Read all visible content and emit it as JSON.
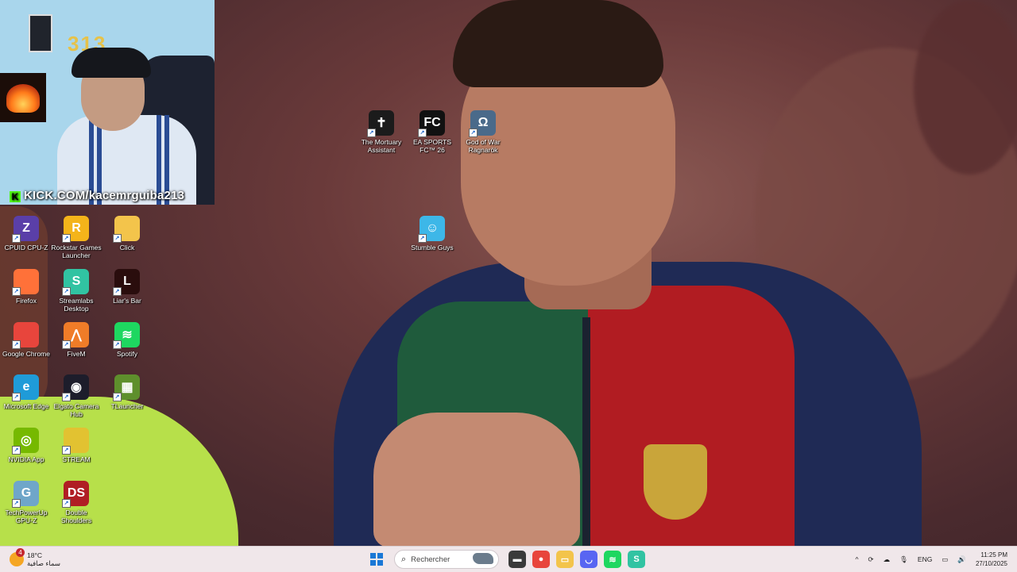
{
  "webcam": {
    "balloon_text": "313",
    "kick_text": "KICK.COM/kacemrguiba213",
    "kick_logo": "K"
  },
  "desktop_icons": [
    {
      "name": "CPUID CPU-Z",
      "icon": "cpu-z-icon",
      "color": "#5a3fa8",
      "glyph": "Z"
    },
    {
      "name": "Rockstar Games Launcher",
      "icon": "rockstar-icon",
      "color": "#f4b41a",
      "glyph": "R"
    },
    {
      "name": "Click",
      "icon": "folder-icon",
      "color": "#f3c44b",
      "glyph": ""
    },
    {
      "name": "Firefox",
      "icon": "firefox-icon",
      "color": "#ff7139",
      "glyph": ""
    },
    {
      "name": "Streamlabs Desktop",
      "icon": "streamlabs-icon",
      "color": "#31c3a2",
      "glyph": "S"
    },
    {
      "name": "Liar's Bar",
      "icon": "liars-bar-icon",
      "color": "#2a0d0d",
      "glyph": "L"
    },
    {
      "name": "Google Chrome",
      "icon": "chrome-icon",
      "color": "#e8453c",
      "glyph": ""
    },
    {
      "name": "FiveM",
      "icon": "fivem-icon",
      "color": "#f07c28",
      "glyph": "⋀"
    },
    {
      "name": "Spotify",
      "icon": "spotify-icon",
      "color": "#1ed760",
      "glyph": "≋"
    },
    {
      "name": "Microsoft Edge",
      "icon": "edge-icon",
      "color": "#1f9bd8",
      "glyph": "e"
    },
    {
      "name": "Elgato Camera Hub",
      "icon": "elgato-icon",
      "color": "#1d1d2b",
      "glyph": "◉"
    },
    {
      "name": "TLauncher",
      "icon": "tlauncher-icon",
      "color": "#5e8f2c",
      "glyph": "▦"
    },
    {
      "name": "NVIDIA App",
      "icon": "nvidia-icon",
      "color": "#76b900",
      "glyph": "◎"
    },
    {
      "name": "STREAM",
      "icon": "stream-folder-icon",
      "color": "#e2c231",
      "glyph": ""
    },
    {
      "name": "TechPowerUp GPU-Z",
      "icon": "gpu-z-icon",
      "color": "#6fa6c9",
      "glyph": "G"
    },
    {
      "name": "Double Shoulders",
      "icon": "double-shoulders-icon",
      "color": "#b01e24",
      "glyph": "DS"
    },
    {
      "name": "The Mortuary Assistant",
      "icon": "mortuary-assistant-icon",
      "color": "#1b1b1b",
      "glyph": "✝"
    },
    {
      "name": "EA SPORTS FC™ 26",
      "icon": "ea-fc-icon",
      "color": "#111111",
      "glyph": "FC"
    },
    {
      "name": "God of War Ragnarök",
      "icon": "god-of-war-icon",
      "color": "#4a6a8a",
      "glyph": "Ω"
    },
    {
      "name": "Stumble Guys",
      "icon": "stumble-guys-icon",
      "color": "#3db7e8",
      "glyph": "☺"
    }
  ],
  "taskbar": {
    "weather_badge": "4",
    "temperature": "18°C",
    "weather_desc": "سماء صافية",
    "search_placeholder": "Rechercher",
    "apps": [
      {
        "icon": "file-explorer-dark-icon",
        "color": "#3a3a3a",
        "glyph": "▬"
      },
      {
        "icon": "chrome-taskbar-icon",
        "color": "#e8453c",
        "glyph": "●"
      },
      {
        "icon": "folder-taskbar-icon",
        "color": "#f3c44b",
        "glyph": "▭"
      },
      {
        "icon": "discord-icon",
        "color": "#5865f2",
        "glyph": "◡"
      },
      {
        "icon": "spotify-taskbar-icon",
        "color": "#1ed760",
        "glyph": "≋"
      },
      {
        "icon": "streamlabs-taskbar-icon",
        "color": "#31c3a2",
        "glyph": "S"
      }
    ],
    "tray": {
      "chevron": "^",
      "language": "ENG",
      "time": "11:25 PM",
      "date": "27/10/2025"
    }
  }
}
